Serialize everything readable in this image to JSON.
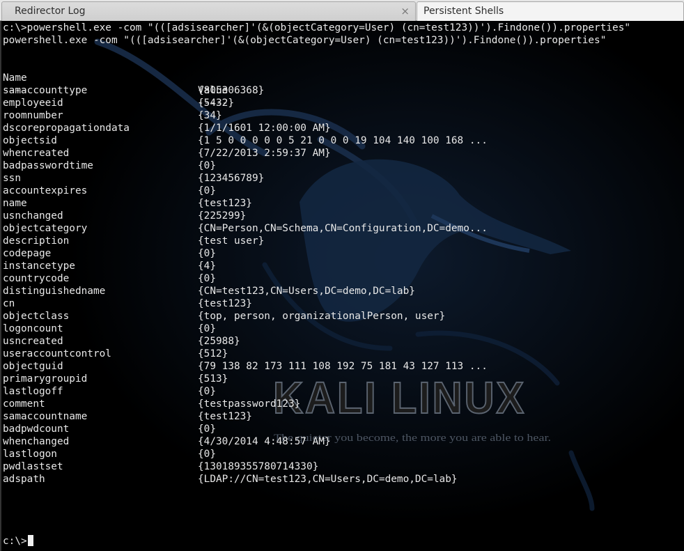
{
  "tabs": [
    {
      "label": "Redirector Log",
      "close": "×"
    },
    {
      "label": "Persistent Shells"
    }
  ],
  "wallpaper": {
    "title": "KALI LINUX",
    "tagline": "The quieter you become, the more you are able to hear."
  },
  "terminal": {
    "command": "c:\\>powershell.exe -com \"(([adsisearcher]'(&(objectCategory=User) (cn=test123))').Findone()).properties\"",
    "echo": "powershell.exe -com \"(([adsisearcher]'(&(objectCategory=User) (cn=test123))').Findone()).properties\"",
    "header": {
      "name": "Name",
      "value": "Value",
      "name_rule": "----",
      "value_rule": "-----"
    },
    "properties": [
      {
        "name": "samaccounttype",
        "value": "{805306368}"
      },
      {
        "name": "employeeid",
        "value": "{5432}"
      },
      {
        "name": "roomnumber",
        "value": "{34}"
      },
      {
        "name": "dscorepropagationdata",
        "value": "{1/1/1601 12:00:00 AM}"
      },
      {
        "name": "objectsid",
        "value": "{1 5 0 0 0 0 0 5 21 0 0 0 19 104 140 100 168 ..."
      },
      {
        "name": "whencreated",
        "value": "{7/22/2013 2:59:37 AM}"
      },
      {
        "name": "badpasswordtime",
        "value": "{0}"
      },
      {
        "name": "ssn",
        "value": "{123456789}"
      },
      {
        "name": "accountexpires",
        "value": "{0}"
      },
      {
        "name": "name",
        "value": "{test123}"
      },
      {
        "name": "usnchanged",
        "value": "{225299}"
      },
      {
        "name": "objectcategory",
        "value": "{CN=Person,CN=Schema,CN=Configuration,DC=demo..."
      },
      {
        "name": "description",
        "value": "{test user}"
      },
      {
        "name": "codepage",
        "value": "{0}"
      },
      {
        "name": "instancetype",
        "value": "{4}"
      },
      {
        "name": "countrycode",
        "value": "{0}"
      },
      {
        "name": "distinguishedname",
        "value": "{CN=test123,CN=Users,DC=demo,DC=lab}"
      },
      {
        "name": "cn",
        "value": "{test123}"
      },
      {
        "name": "objectclass",
        "value": "{top, person, organizationalPerson, user}"
      },
      {
        "name": "logoncount",
        "value": "{0}"
      },
      {
        "name": "usncreated",
        "value": "{25988}"
      },
      {
        "name": "useraccountcontrol",
        "value": "{512}"
      },
      {
        "name": "objectguid",
        "value": "{79 138 82 173 111 108 192 75 181 43 127 113 ..."
      },
      {
        "name": "primarygroupid",
        "value": "{513}"
      },
      {
        "name": "lastlogoff",
        "value": "{0}"
      },
      {
        "name": "comment",
        "value": "{testpassword123}"
      },
      {
        "name": "samaccountname",
        "value": "{test123}"
      },
      {
        "name": "badpwdcount",
        "value": "{0}"
      },
      {
        "name": "whenchanged",
        "value": "{4/30/2014 4:48:57 AM}"
      },
      {
        "name": "lastlogon",
        "value": "{0}"
      },
      {
        "name": "pwdlastset",
        "value": "{130189355780714330}"
      },
      {
        "name": "adspath",
        "value": "{LDAP://CN=test123,CN=Users,DC=demo,DC=lab}"
      }
    ],
    "prompt": "c:\\>"
  }
}
